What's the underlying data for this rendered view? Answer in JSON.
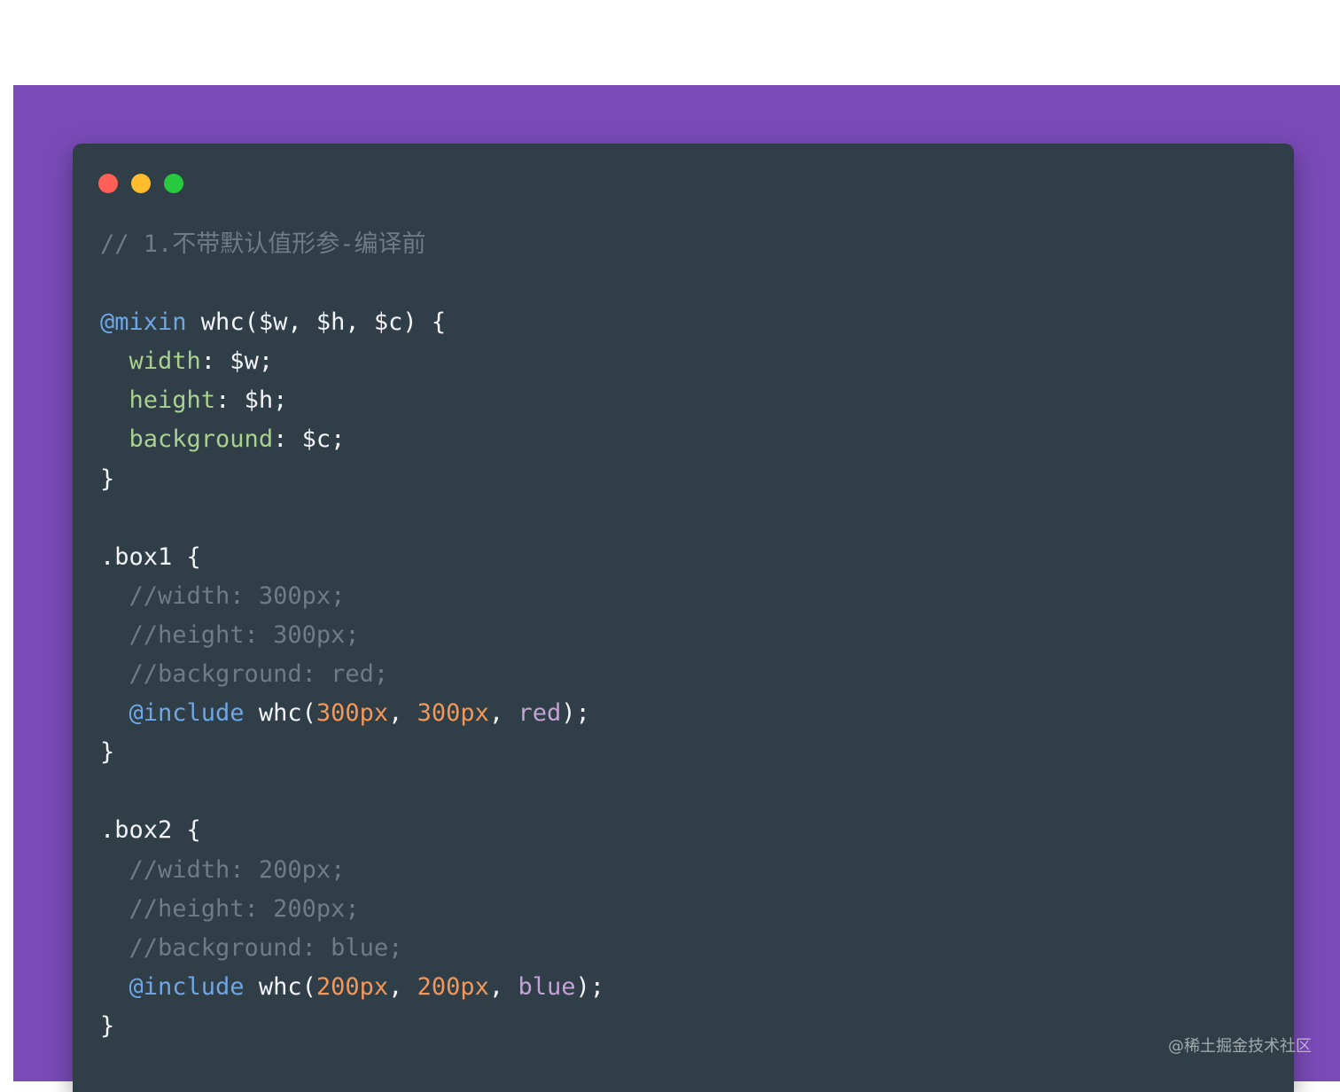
{
  "colors": {
    "page_background": "#ffffff",
    "frame_background": "#7a4bb8",
    "editor_background": "#2f3e47",
    "comment": "#6d7c86",
    "at_rule": "#6ea6e6",
    "property": "#a9d18e",
    "number": "#f2975a",
    "string_value": "#c3a2d6",
    "plain_text": "#f2f4f7"
  },
  "window_controls": {
    "close": "red-dot-icon",
    "minimize": "yellow-dot-icon",
    "maximize": "green-dot-icon"
  },
  "code": {
    "lines": [
      {
        "t": "c",
        "text": "// 1.不带默认值形参-编译前"
      },
      {
        "t": "blank",
        "text": ""
      },
      {
        "t": "mixin",
        "at": "@mixin",
        "rest": " whc($w, $h, $c) {"
      },
      {
        "t": "decl",
        "prop": "width",
        "rest": ": $w;"
      },
      {
        "t": "decl",
        "prop": "height",
        "rest": ": $h;"
      },
      {
        "t": "decl",
        "prop": "background",
        "rest": ": $c;"
      },
      {
        "t": "p",
        "text": "}"
      },
      {
        "t": "blank",
        "text": ""
      },
      {
        "t": "p",
        "text": ".box1 {"
      },
      {
        "t": "ci",
        "text": "//width: 300px;"
      },
      {
        "t": "ci",
        "text": "//height: 300px;"
      },
      {
        "t": "ci",
        "text": "//background: red;"
      },
      {
        "t": "inc",
        "at": "@include",
        "fn": " whc(",
        "a1": "300px",
        "s1": ", ",
        "a2": "300px",
        "s2": ", ",
        "a3": "red",
        "end": ");"
      },
      {
        "t": "p",
        "text": "}"
      },
      {
        "t": "blank",
        "text": ""
      },
      {
        "t": "p",
        "text": ".box2 {"
      },
      {
        "t": "ci",
        "text": "//width: 200px;"
      },
      {
        "t": "ci",
        "text": "//height: 200px;"
      },
      {
        "t": "ci",
        "text": "//background: blue;"
      },
      {
        "t": "inc",
        "at": "@include",
        "fn": " whc(",
        "a1": "200px",
        "s1": ", ",
        "a2": "200px",
        "s2": ", ",
        "a3": "blue",
        "end": ");"
      },
      {
        "t": "p",
        "text": "}"
      }
    ]
  },
  "watermark": "@稀土掘金技术社区"
}
